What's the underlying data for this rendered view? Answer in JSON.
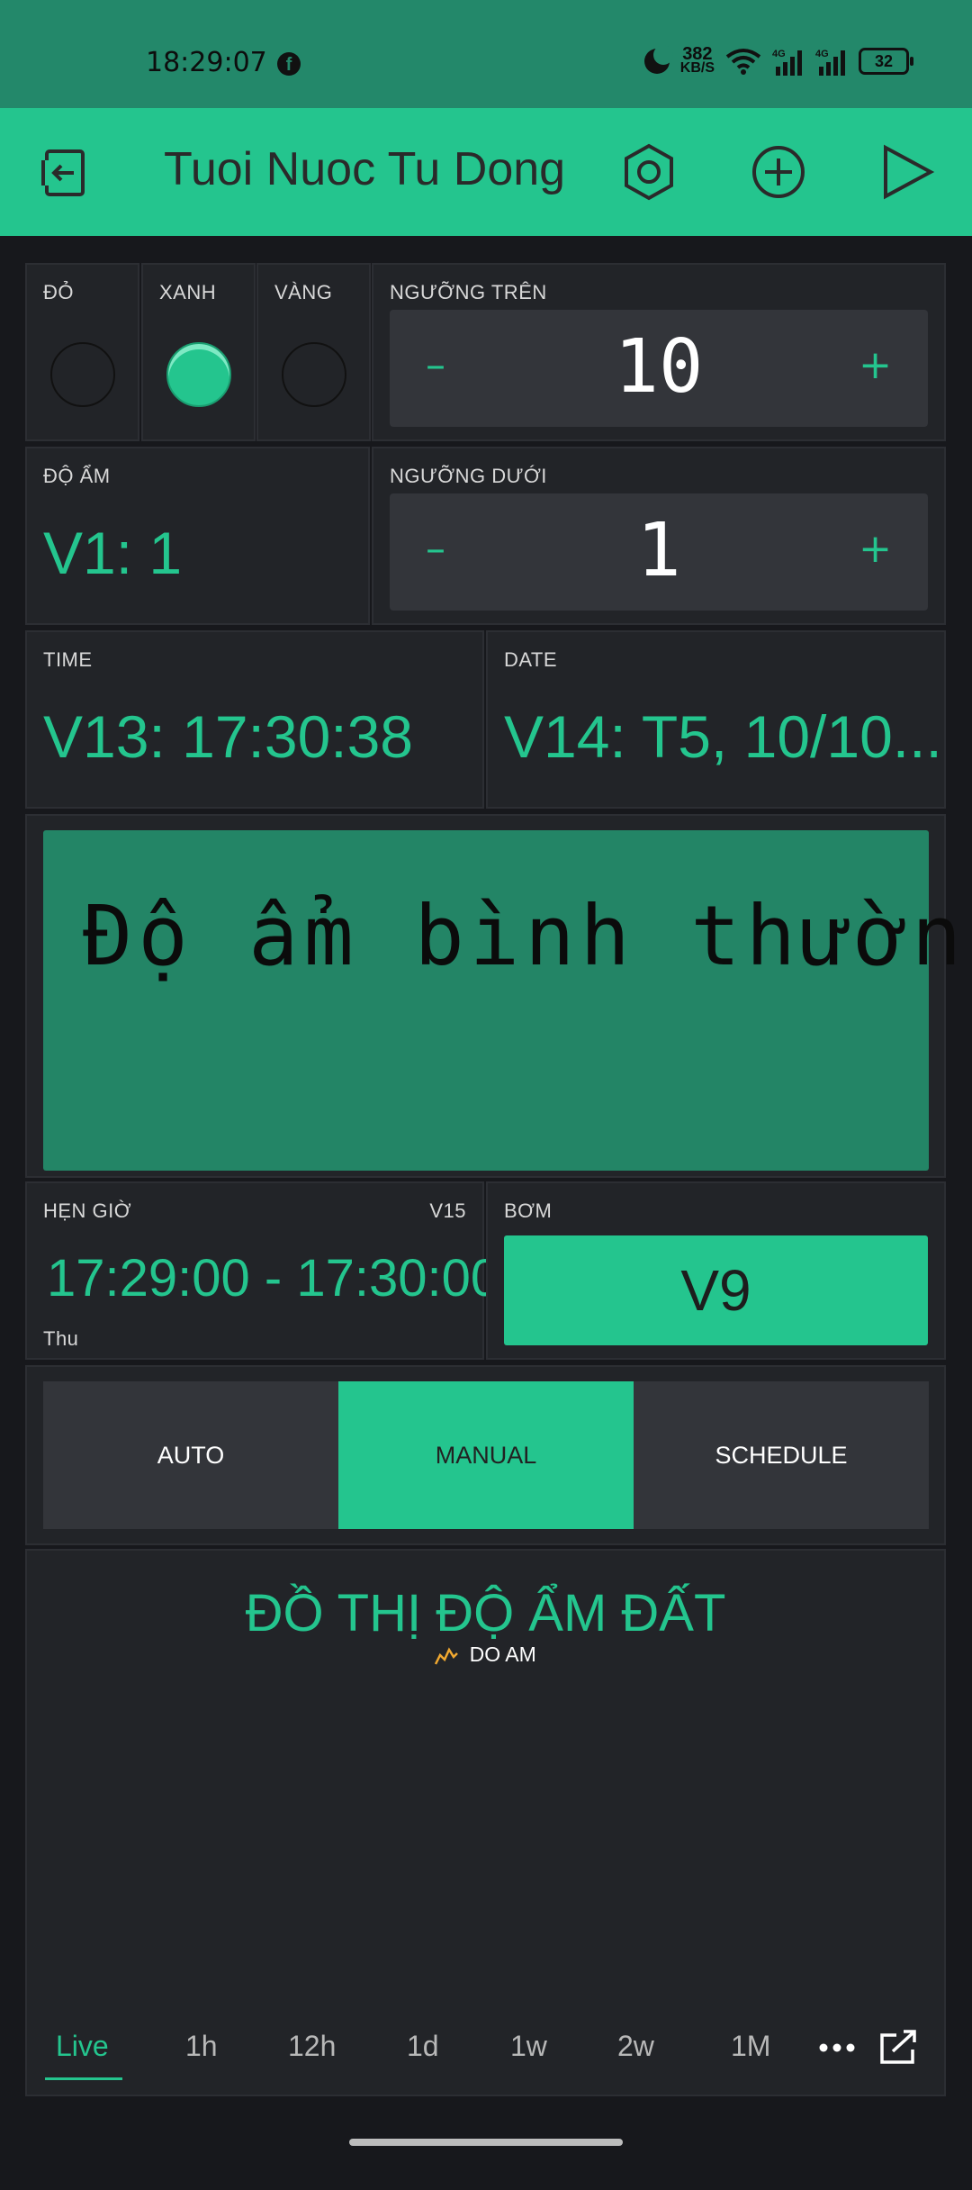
{
  "status_bar": {
    "time": "18:29:07",
    "speed_value": "382",
    "speed_unit": "KB/S",
    "battery": "32",
    "network1": "4G",
    "network2": "4G"
  },
  "app_bar": {
    "title": "Tuoi Nuoc Tu Dong"
  },
  "leds": [
    {
      "label": "ĐỎ",
      "on": false
    },
    {
      "label": "XANH",
      "on": true
    },
    {
      "label": "VÀNG",
      "on": false
    }
  ],
  "threshold_upper": {
    "label": "NGƯỠNG TRÊN",
    "value": "10",
    "minus": "–",
    "plus": "+"
  },
  "humidity": {
    "label": "ĐỘ ẨM",
    "value": "V1: 1"
  },
  "threshold_lower": {
    "label": "NGƯỠNG DƯỚI",
    "value": "1",
    "minus": "–",
    "plus": "+"
  },
  "time_widget": {
    "label": "TIME",
    "value": "V13: 17:30:38"
  },
  "date_widget": {
    "label": "DATE",
    "value": "V14: T5, 10/10..."
  },
  "lcd": {
    "text": "Độ ẩm bình thườn"
  },
  "timer": {
    "label": "HẸN GIỜ",
    "pin": "V15",
    "value": "17:29:00 - 17:30:00",
    "day": "Thu"
  },
  "pump": {
    "label": "BƠM",
    "button": "V9"
  },
  "mode_tabs": {
    "items": [
      "AUTO",
      "MANUAL",
      "SCHEDULE"
    ],
    "active": "MANUAL"
  },
  "chart": {
    "title": "ĐỒ THỊ ĐỘ ẨM ĐẤT",
    "legend": "DO AM",
    "legend_color": "#f0a830"
  },
  "chart_data": {
    "type": "line",
    "title": "ĐỒ THỊ ĐỘ ẨM ĐẤT",
    "series": [
      {
        "name": "DO AM",
        "values": []
      }
    ],
    "xlabel": "",
    "ylabel": ""
  },
  "time_ranges": {
    "items": [
      "Live",
      "1h",
      "12h",
      "1d",
      "1w",
      "2w",
      "1M"
    ],
    "active": "Live"
  },
  "colors": {
    "accent": "#24c58e",
    "status_bar": "#23886a",
    "lcd": "#238566",
    "card": "#222428",
    "background": "#17181c"
  }
}
